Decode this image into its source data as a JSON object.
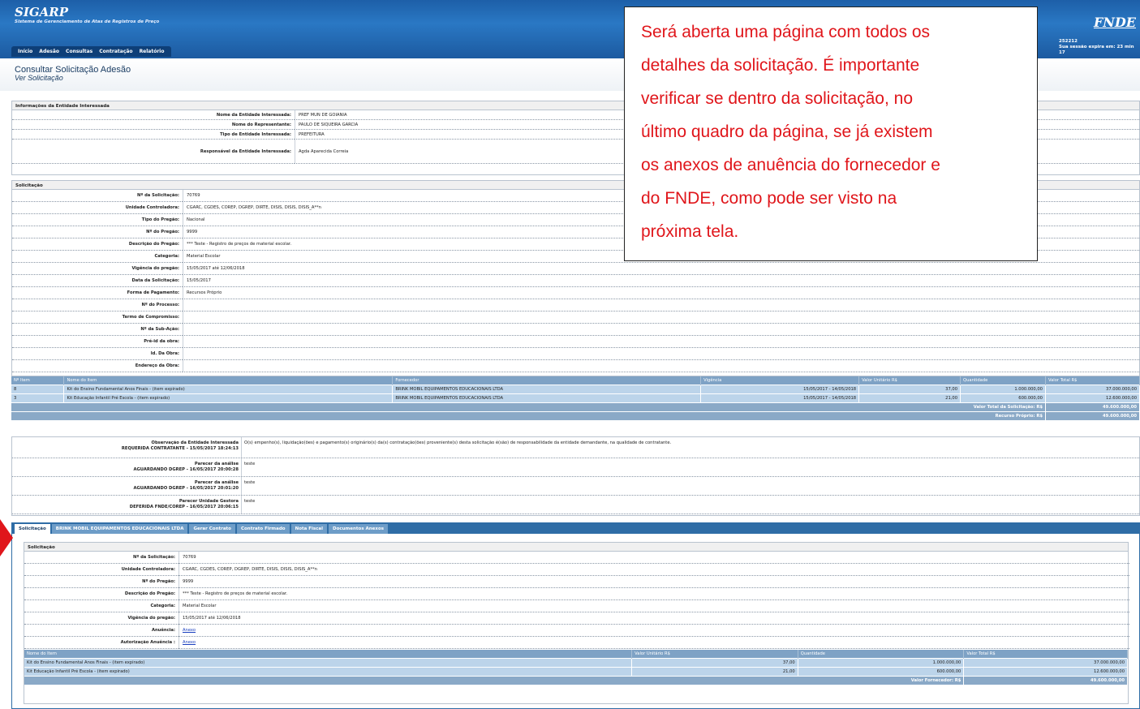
{
  "header": {
    "brand": "SIGARP",
    "brand_subtitle": "Sistema de Gerenciamento de Atas de Registros de Preço",
    "logo": "FNDE",
    "user_id": "252212",
    "session_text": "Sua sessão expira em: 23 min 17"
  },
  "menu": [
    "Início",
    "Adesão",
    "Consultas",
    "Contratação",
    "Relatório"
  ],
  "page": {
    "title": "Consultar Solicitação Adesão",
    "subtitle": "Ver Solicitação"
  },
  "entidade": {
    "heading": "Informações da Entidade Interessada",
    "rows": [
      {
        "label": "Nome da Entidade Interessada:",
        "value": "PREF MUN DE GOIANIA"
      },
      {
        "label": "Nome do Representante:",
        "value": "PAULO DE SIQUEIRA GARCIA"
      },
      {
        "label": "Tipo de Entidade Interessada:",
        "value": "PREFEITURA"
      },
      {
        "label": "Responsável da Entidade Interessada:",
        "value": "Agda Aparecida Correia"
      }
    ]
  },
  "solicitacao": {
    "heading": "Solicitação",
    "rows": [
      {
        "label": "Nº da Solicitação:",
        "value": "70769"
      },
      {
        "label": "Unidade Controladora:",
        "value": "CGARC, CGDES, COREP, DGREP, DIRTE, DISIS, DISIS, DISIS_A**n"
      },
      {
        "label": "Tipo do Pregão:",
        "value": "Nacional"
      },
      {
        "label": "Nº do Pregão:",
        "value": "9999"
      },
      {
        "label": "Descrição do Pregão:",
        "value": "*** Teste - Registro de preços de material escolar."
      },
      {
        "label": "Categoria:",
        "value": "Material Escolar"
      },
      {
        "label": "Vigência do pregão:",
        "value": "15/05/2017 até 12/06/2018"
      },
      {
        "label": "Data da Solicitação:",
        "value": "15/05/2017"
      },
      {
        "label": "Forma de Pagamento:",
        "value": "Recursos Próprio"
      },
      {
        "label": "Nº do Processo:",
        "value": ""
      },
      {
        "label": "Termo de Compromisso:",
        "value": ""
      },
      {
        "label": "Nº da Sub-Ação:",
        "value": ""
      },
      {
        "label": "Pré-id da obra:",
        "value": ""
      },
      {
        "label": "Id. Da Obra:",
        "value": ""
      },
      {
        "label": "Endereço da Obra:",
        "value": ""
      }
    ]
  },
  "itens": {
    "columns": [
      "Nº Item",
      "Nome do Item",
      "Fornecedor",
      "Vigência",
      "Valor Unitário R$",
      "Quantidade",
      "Valor Total R$"
    ],
    "rows": [
      [
        "8",
        "Kit do Ensino Fundamental Anos Finais - (item expirado)",
        "BRINK MOBIL EQUIPAMENTOS EDUCACIONAIS LTDA",
        "15/05/2017 - 14/05/2018",
        "37,00",
        "1.000.000,00",
        "37.000.000,00"
      ],
      [
        "3",
        "Kit Educação Infantil Pré Escola - (item expirado)",
        "BRINK MOBIL EQUIPAMENTOS EDUCACIONAIS LTDA",
        "15/05/2017 - 14/05/2018",
        "21,00",
        "600.000,00",
        "12.600.000,00"
      ]
    ],
    "total_label": "Valor Total da Solicitação: R$",
    "total_value": "49.600.000,00",
    "recurso_label": "Recurso Próprio: R$",
    "recurso_value": "49.600.000,00"
  },
  "pareceres": [
    {
      "title": "Observação da Entidade Interessada",
      "status": "REQUERIDA CONTRATANTE - 15/05/2017 18:24:13",
      "text": "O(s) empenho(s), liquidação(ões) e pagamento(s) originário(s) da(s) contratação(ões) proveniente(s) desta solicitação é(são) de responsabilidade da entidade demandante, na qualidade de contratante."
    },
    {
      "title": "Parecer da análise",
      "status": "AGUARDANDO DGREP - 16/05/2017 20:00:28",
      "text": "teste"
    },
    {
      "title": "Parecer da análise",
      "status": "AGUARDANDO DGREP - 16/05/2017 20:01:20",
      "text": "teste"
    },
    {
      "title": "Parecer Unidade Gestora",
      "status": "DEFERIDA FNDE/COREP - 16/05/2017 20:06:15",
      "text": "teste"
    }
  ],
  "tabs": [
    "Solicitação",
    "BRINK MOBIL EQUIPAMENTOS EDUCACIONAIS LTDA",
    "Gerar Contrato",
    "Contrato Firmado",
    "Nota Fiscal",
    "Documentos Anexos"
  ],
  "sol2": {
    "heading": "Solicitação",
    "rows": [
      {
        "label": "Nº da Solicitação:",
        "value": "70769"
      },
      {
        "label": "Unidade Controladora:",
        "value": "CGARC, CGDES, COREP, DGREP, DIRTE, DISIS, DISIS, DISIS_A**n"
      },
      {
        "label": "Nº do Pregão:",
        "value": "9999"
      },
      {
        "label": "Descrição do Pregão:",
        "value": "*** Teste - Registro de preços de material escolar."
      },
      {
        "label": "Categoria:",
        "value": "Material Escolar"
      },
      {
        "label": "Vigência do pregão:",
        "value": "15/05/2017 até 12/06/2018"
      }
    ],
    "anuencia_label": "Anuência:",
    "anuencia_link": "Anexo",
    "autorizacao_label": "Autorização Anuência :",
    "autorizacao_link": "Anexo",
    "columns": [
      "Nome do Item",
      "Valor Unitário R$",
      "Quantidade",
      "Valor Total R$"
    ],
    "items": [
      [
        "Kit do Ensino Fundamental Anos Finais - (item expirado)",
        "37,00",
        "1.000.000,00",
        "37.000.000,00"
      ],
      [
        "Kit Educação Infantil Pré Escola - (item expirado)",
        "21,00",
        "600.000,00",
        "12.600.000,00"
      ]
    ],
    "total_label": "Valor Fornecedor: R$",
    "total_value": "49.600.000,00"
  },
  "callout": {
    "lines": [
      "Será aberta uma página com todos os",
      "detalhes da solicitação. É importante",
      "verificar se dentro da solicitação, no",
      "último quadro da página, se já existem",
      "os anexos de anuência do fornecedor e",
      "do FNDE, como pode ser visto na",
      "próxima tela."
    ],
    "color": "#e0161b"
  }
}
